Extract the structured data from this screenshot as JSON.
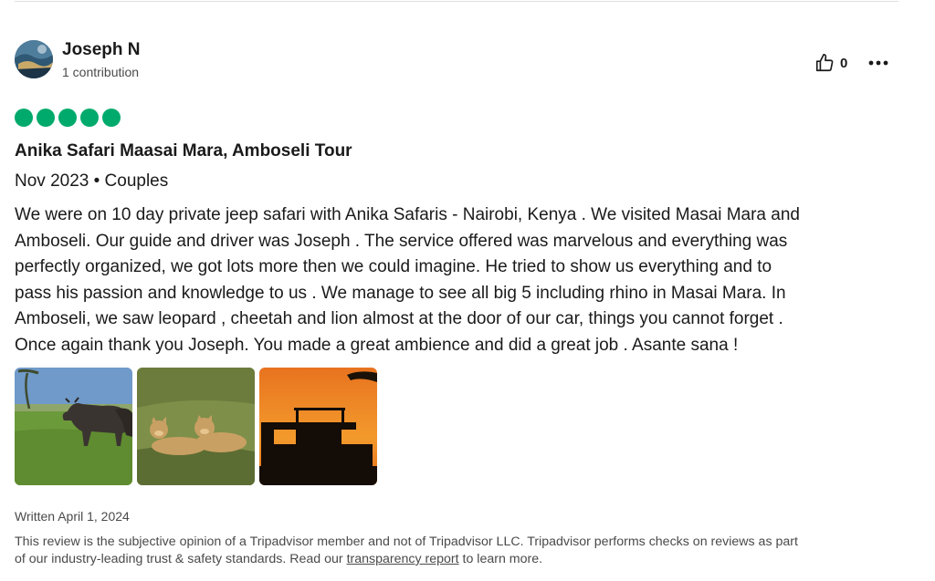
{
  "reviewer": {
    "name": "Joseph N",
    "contributions": "1 contribution",
    "avatar_icon": "user-avatar"
  },
  "helpful": {
    "icon": "thumbs-up-icon",
    "count": "0"
  },
  "more_menu": {
    "icon": "more-horizontal-icon"
  },
  "rating": {
    "value": 5,
    "max": 5,
    "color": "#00aa6c"
  },
  "review": {
    "title": "Anika Safari Maasai Mara, Amboseli Tour",
    "trip_info": "Nov 2023 • Couples",
    "body_lines": [
      "We were on 10 day private jeep safari with Anika Safaris - Nairobi, Kenya . We visited Masai Mara and",
      "Amboseli. Our guide and driver was Joseph . The service offered was marvelous and everything was",
      "perfectly organized, we got lots more then we could imagine. He tried to show us everything and to",
      "pass his passion and knowledge to us . We manage to see all big 5 including rhino in Masai Mara. In",
      "Amboseli, we saw leopard , cheetah and lion almost at the door of our car, things you cannot forget .",
      "Once again thank you Joseph. You made a great ambience and did a great job . Asante sana !"
    ]
  },
  "photos": [
    {
      "subject": "wildebeest-on-grassland"
    },
    {
      "subject": "lion-cubs-resting"
    },
    {
      "subject": "safari-jeep-silhouette-sunset"
    }
  ],
  "written_date": "Written April 1, 2024",
  "disclaimer": {
    "line1": "This review is the subjective opinion of a Tripadvisor member and not of Tripadvisor LLC. Tripadvisor performs checks on reviews as part",
    "line2_before": "of our industry-leading trust & safety standards. Read our ",
    "link_text": "transparency report",
    "line2_after": " to learn more."
  }
}
